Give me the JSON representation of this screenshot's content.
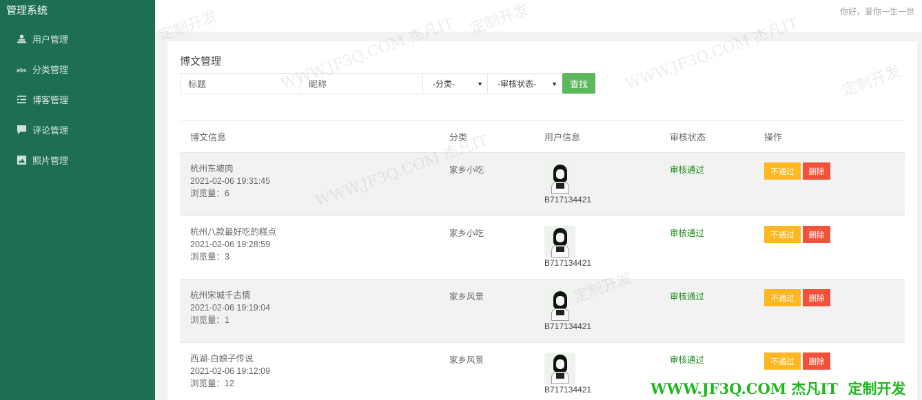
{
  "sidebar": {
    "brand": "管理系统",
    "items": [
      {
        "label": "用户管理",
        "icon": "user-icon"
      },
      {
        "label": "分类管理",
        "icon": "abc-icon"
      },
      {
        "label": "博客管理",
        "icon": "list-indent-icon"
      },
      {
        "label": "评论管理",
        "icon": "comment-icon"
      },
      {
        "label": "照片管理",
        "icon": "image-icon"
      }
    ]
  },
  "header": {
    "greeting": "你好，爱你一生一世"
  },
  "panel": {
    "title": "博文管理",
    "filter": {
      "title_placeholder": "标题",
      "nickname_placeholder": "昵称",
      "category_select": "-分类-",
      "audit_select": "-审核状态-",
      "search_label": "查找"
    },
    "table": {
      "headers": [
        "博文信息",
        "分类",
        "用户信息",
        "审核状态",
        "操作"
      ],
      "rows": [
        {
          "title": "杭州东坡肉",
          "time": "2021-02-06 19:31:45",
          "views": "浏览量：6",
          "category": "家乡小吃",
          "user": "B717134421",
          "status": "审核通过",
          "reject": "不通过",
          "delete": "删除"
        },
        {
          "title": "杭州八款最好吃的糕点",
          "time": "2021-02-06 19:28:59",
          "views": "浏览量：3",
          "category": "家乡小吃",
          "user": "B717134421",
          "status": "审核通过",
          "reject": "不通过",
          "delete": "删除"
        },
        {
          "title": "杭州宋城千古情",
          "time": "2021-02-06 19:19:04",
          "views": "浏览量：1",
          "category": "家乡风景",
          "user": "B717134421",
          "status": "审核通过",
          "reject": "不通过",
          "delete": "删除"
        },
        {
          "title": "西湖-白娘子传说",
          "time": "2021-02-06 19:12:09",
          "views": "浏览量：12",
          "category": "家乡风景",
          "user": "B717134421",
          "status": "审核通过",
          "reject": "不通过",
          "delete": "删除"
        }
      ]
    }
  },
  "watermark": {
    "bottom": "WWW.JF3Q.COM 杰凡IT  定制开发",
    "texts": [
      "定制开发",
      "WWW.JF3Q.COM 杰凡IT",
      "定制开发",
      "WWW.JF3Q.COM 杰凡IT",
      "定制开发",
      "WWW.JF3Q.COM 杰凡IT",
      "定制开发"
    ]
  }
}
